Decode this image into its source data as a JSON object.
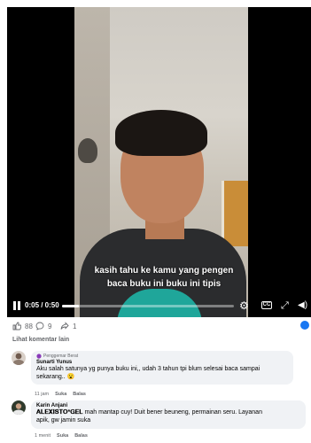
{
  "video": {
    "caption_line1": "kasih tahu ke kamu yang pengen",
    "caption_line2": "baca buku ini buku ini tipis",
    "time": "0:05 / 0:50",
    "progress": 0.1,
    "cc_label": "CC"
  },
  "reactions": {
    "likes": "88",
    "comments": "9",
    "shares": "1"
  },
  "more_comments_label": "Lihat komentar lain",
  "comments": [
    {
      "badge": "Penggemar Berat",
      "name": "Sunarti Yunus",
      "text_line1": "Aku salah satunya yg punya buku ini,, udah 3 tahun tpi blum selesai baca sampai",
      "text_line2": "sekarang.. 😮",
      "time": "11 jam",
      "like": "Suka",
      "reply": "Balas"
    },
    {
      "name": "Karin Anjani",
      "text_brand": "𝐀𝐋𝐄𝐗𝐈𝐒𝐓𝐎*𝐆𝐄𝐋",
      "text_line1_rest": " mah mantap cuy! Duit bener beuneng, permainan seru. Layanan",
      "text_line2": "apik, gw jamin suka",
      "time": "1 menit",
      "like": "Suka",
      "reply": "Balas"
    }
  ],
  "colors": {
    "accent": "#1877f2",
    "comment_bg": "#f0f2f5",
    "meta_text": "#65676b",
    "badge_icon": "#8a3ab9"
  },
  "icons": [
    "pause-icon",
    "settings-gear-icon",
    "captions-icon",
    "fullscreen-icon",
    "volume-icon",
    "like-icon",
    "comment-icon",
    "share-icon",
    "fan-badge-icon"
  ]
}
